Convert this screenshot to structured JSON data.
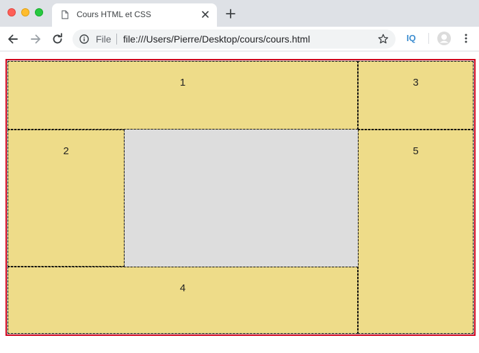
{
  "browser": {
    "tab": {
      "title": "Cours HTML et CSS",
      "close_icon": "close-icon"
    },
    "new_tab_icon": "plus-icon",
    "omnibox": {
      "scheme_label": "File",
      "url": "file:///Users/Pierre/Desktop/cours/cours.html"
    },
    "extension_label": "IQ"
  },
  "colors": {
    "cell_fill": "#eedc89",
    "container_border": "#d0021b",
    "empty_area": "#dddddd"
  },
  "grid": {
    "cells": [
      {
        "label": "1"
      },
      {
        "label": "2"
      },
      {
        "label": "3"
      },
      {
        "label": "4"
      },
      {
        "label": "5"
      }
    ]
  }
}
